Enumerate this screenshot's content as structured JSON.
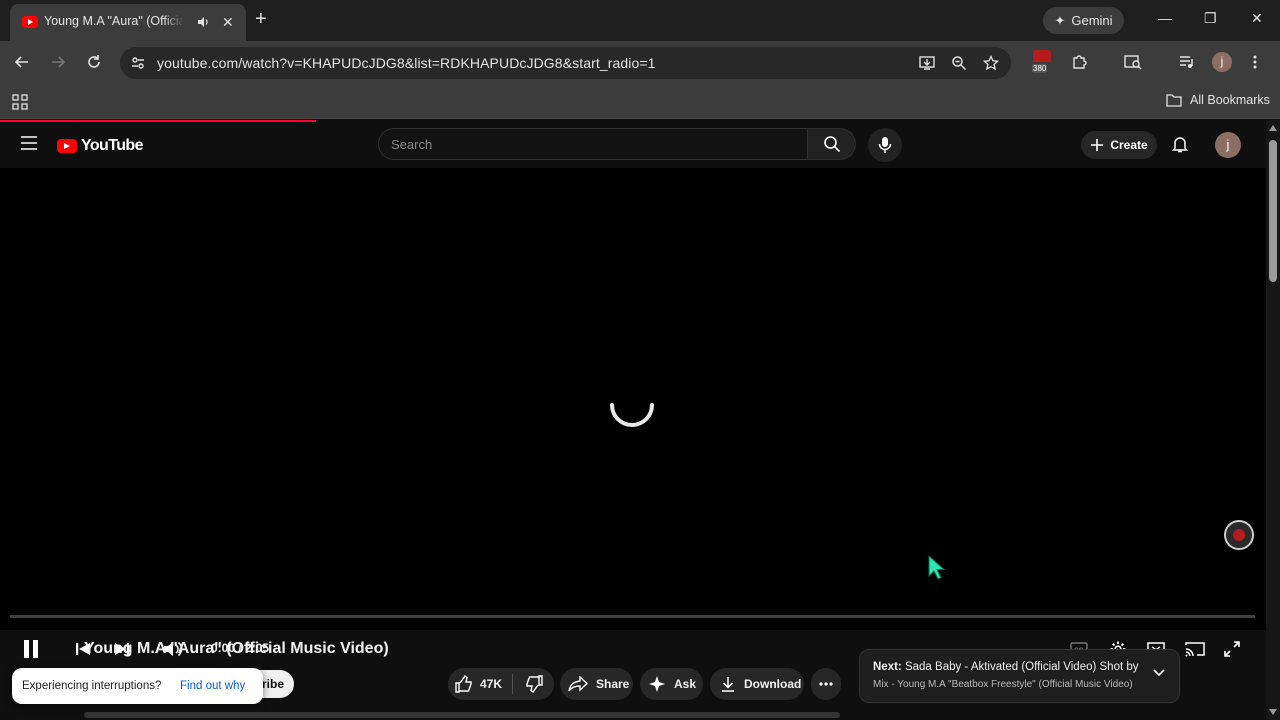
{
  "browser": {
    "tab": {
      "title": "Young M.A \"Aura\" (Official Music Video) - YouTube"
    },
    "gemini_label": "Gemini",
    "url": "youtube.com/watch?v=KHAPUDcJDG8&list=RDKHAPUDcJDG8&start_radio=1",
    "extension_badge": "380",
    "profile_initial": "j",
    "all_bookmarks": "All Bookmarks"
  },
  "youtube": {
    "logo_text": "YouTube",
    "search_placeholder": "Search",
    "create_label": "Create",
    "avatar_initial": "j",
    "player": {
      "time": "0:00 / 2:05",
      "state": "loading"
    },
    "video": {
      "title": "Young M.A \"Aura\" (Official Music Video)",
      "subscribe_fragment": "ribe",
      "likes": "47K",
      "share_label": "Share",
      "ask_label": "Ask",
      "download_label": "Download"
    },
    "interruption": {
      "message": "Experiencing interruptions?",
      "link": "Find out why"
    },
    "next": {
      "prefix": "Next:",
      "title": "Sada Baby - Aktivated (Official Video) Shot by ...",
      "subtitle": "Mix - Young M.A \"Beatbox Freestyle\" (Official Music Video)"
    }
  },
  "colors": {
    "accent_red": "#ff0033",
    "chrome_toolbar": "#3c3c3c",
    "page_bg": "#0f0f0f",
    "cursor": "#2ee6b0"
  }
}
